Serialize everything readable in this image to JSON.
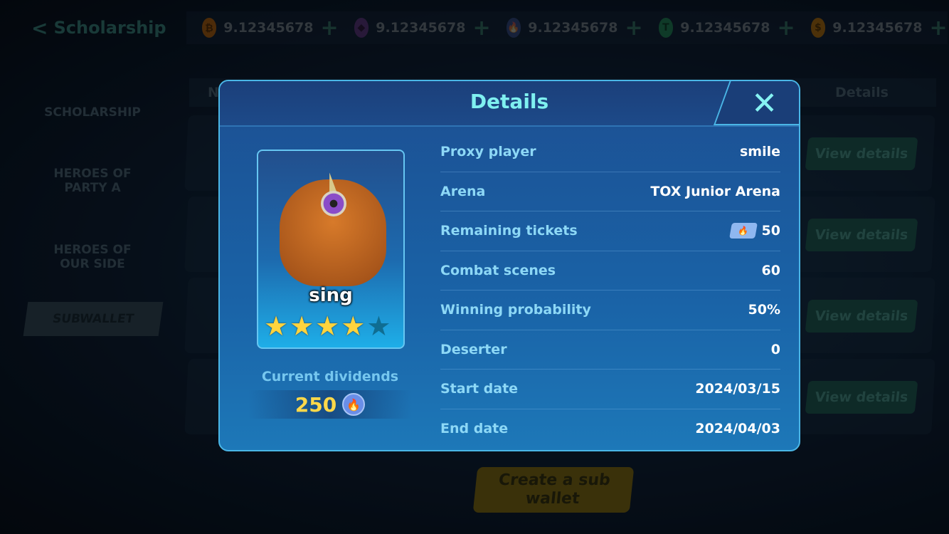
{
  "header": {
    "title": "Scholarship",
    "currencies": [
      {
        "icon": "bitcoin-icon",
        "symbol": "₿",
        "color": "#8a4f12",
        "amount": "9.12345678"
      },
      {
        "icon": "ethereum-icon",
        "symbol": "◆",
        "color": "#4a2f68",
        "amount": "9.12345678"
      },
      {
        "icon": "fire-token-icon",
        "symbol": "🔥",
        "color": "#2a3d6a",
        "amount": "9.12345678"
      },
      {
        "icon": "tether-icon",
        "symbol": "T",
        "color": "#1d6a4a",
        "amount": "9.12345678"
      },
      {
        "icon": "dollar-coin-icon",
        "symbol": "$",
        "color": "#8a5a12",
        "amount": "9.12345678"
      }
    ]
  },
  "sidebar": {
    "items": [
      {
        "label": "SCHOLARSHIP"
      },
      {
        "label": "HEROES OF PARTY A"
      },
      {
        "label": "HEROES OF OUR SIDE"
      },
      {
        "label": "SUBWALLET"
      }
    ]
  },
  "table": {
    "col_first": "N",
    "col_details": "Details",
    "view_details": "View details"
  },
  "create_button": "Create a sub wallet",
  "modal": {
    "title": "Details",
    "hero": {
      "name": "sing",
      "stars": 4,
      "max_stars": 5
    },
    "dividends_label": "Current dividends",
    "dividends_value": "250",
    "rows": [
      {
        "label": "Proxy player",
        "value": "smile"
      },
      {
        "label": "Arena",
        "value": "TOX Junior Arena"
      },
      {
        "label": "Remaining tickets",
        "value": "50"
      },
      {
        "label": "Combat scenes",
        "value": "60"
      },
      {
        "label": "Winning probability",
        "value": "50%"
      },
      {
        "label": "Deserter",
        "value": "0"
      },
      {
        "label": "Start date",
        "value": "2024/03/15"
      },
      {
        "label": "End date",
        "value": "2024/04/03"
      }
    ]
  }
}
